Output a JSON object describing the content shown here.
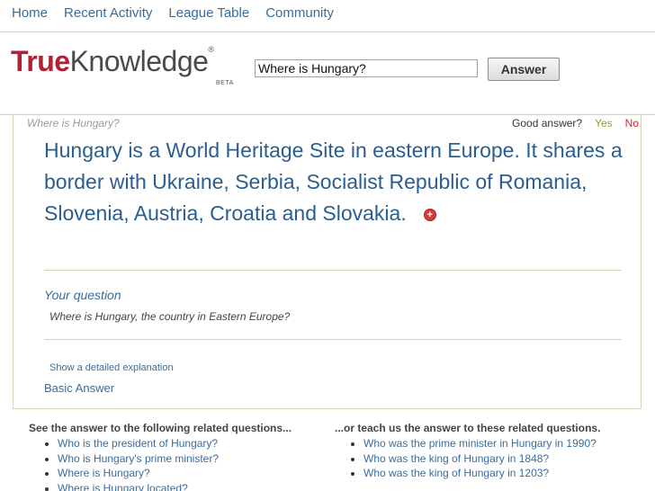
{
  "nav": {
    "items": [
      "Home",
      "Recent Activity",
      "League Table",
      "Community"
    ]
  },
  "logo": {
    "true_text": "True",
    "knowledge_text": "Knowledge",
    "reg_mark": "®",
    "beta": "BETA"
  },
  "search": {
    "value": "Where is Hungary?",
    "button_label": "Answer"
  },
  "answer": {
    "question_echo": "Where is Hungary?",
    "feedback_label": "Good answer?",
    "yes_label": "Yes",
    "no_label": "No",
    "text": "Hungary is a World Heritage Site in eastern Europe. It shares a border with Ukraine, Serbia, Socialist Republic of Romania, Slovenia, Austria, Croatia and Slovakia.",
    "plus_icon": "+",
    "your_question_label": "Your question",
    "your_question_text": "Where is Hungary, the country in Eastern Europe?",
    "detail_link": "Show a detailed explanation",
    "basic_link": "Basic Answer"
  },
  "related": {
    "left_heading": "See the answer to the following related questions...",
    "left_items": [
      "Who is the president of Hungary?",
      "Who is Hungary's prime minister?",
      "Where is Hungary?",
      "Where is Hungary located?"
    ],
    "right_heading": "...or teach us the answer to these related questions.",
    "right_items": [
      "Who was the prime minister in Hungary in 1990?",
      "Who was the king of Hungary in 1848?",
      "Who was the king of Hungary in 1203?"
    ]
  },
  "colors": {
    "link": "#3a6c9e",
    "brand_red": "#b02235",
    "answer_blue": "#2b5e8f",
    "yes_green": "#8aa817",
    "no_red": "#d2242b",
    "divider": "#d9d2b6"
  }
}
